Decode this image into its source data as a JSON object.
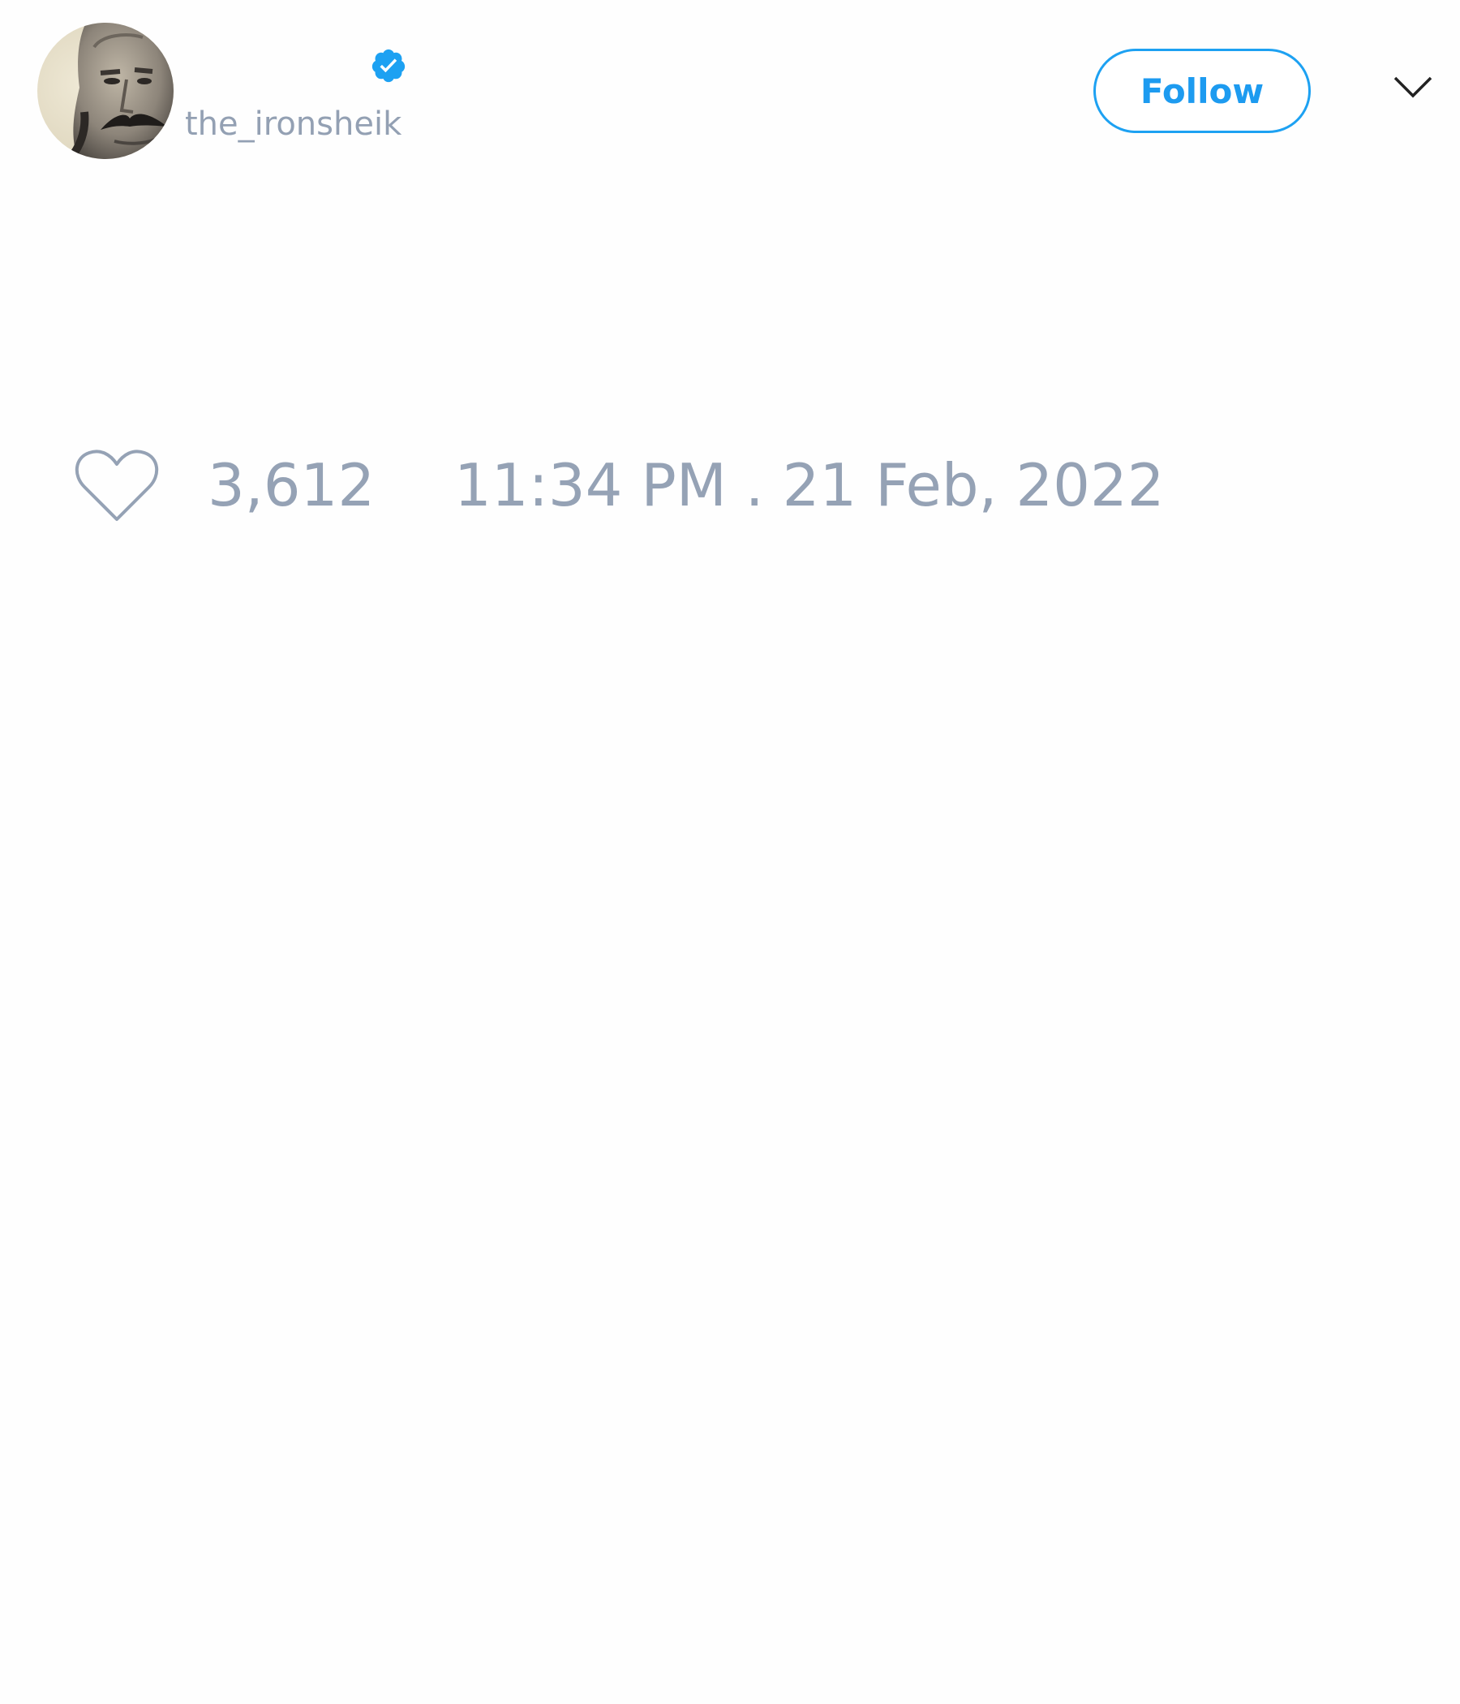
{
  "author": {
    "handle": "the_ironsheik",
    "verified": true,
    "avatar_icon": "profile-photo-man-with-mustache"
  },
  "actions": {
    "follow_label": "Follow",
    "menu_icon": "chevron-down-icon"
  },
  "stats": {
    "like_icon": "heart-outline-icon",
    "likes": "3,612",
    "timestamp": "11:34 PM . 21 Feb, 2022"
  },
  "colors": {
    "accent": "#1da1f2",
    "muted_text": "#95a2b5",
    "background": "#fefefe"
  }
}
